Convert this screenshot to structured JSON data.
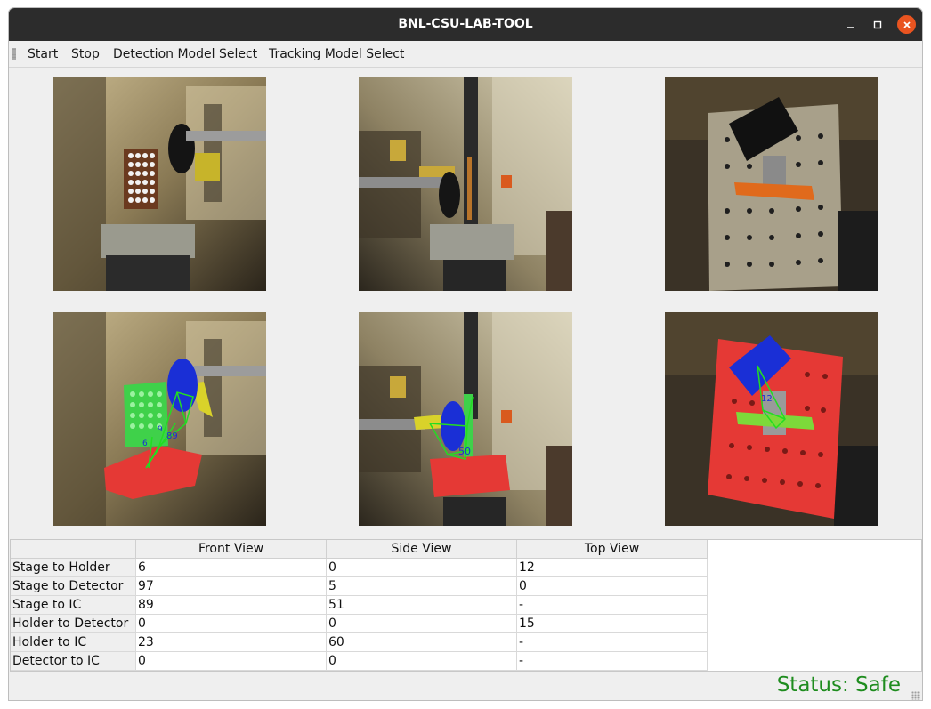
{
  "window": {
    "title": "BNL-CSU-LAB-TOOL",
    "controls": [
      "minimize-icon",
      "maximize-icon",
      "close-icon"
    ]
  },
  "menu": {
    "items": [
      "Start",
      "Stop",
      "Detection Model Select",
      "Tracking Model Select"
    ]
  },
  "images": {
    "raw": [
      "front-view-camera-image",
      "side-view-camera-image",
      "top-view-camera-image"
    ],
    "annotated": [
      "front-view-detection-image",
      "side-view-detection-image",
      "top-view-detection-image"
    ],
    "overlay_labels": {
      "front": [
        "89",
        "6",
        "9"
      ],
      "side": [
        "50"
      ],
      "top": [
        "12"
      ]
    }
  },
  "table": {
    "columns": [
      "Front View",
      "Side View",
      "Top View"
    ],
    "rows": [
      {
        "label": "Stage to Holder",
        "values": [
          "6",
          "0",
          "12"
        ]
      },
      {
        "label": "Stage to Detector",
        "values": [
          "97",
          "5",
          "0"
        ]
      },
      {
        "label": "Stage to IC",
        "values": [
          "89",
          "51",
          "-"
        ]
      },
      {
        "label": "Holder to Detector",
        "values": [
          "0",
          "0",
          "15"
        ]
      },
      {
        "label": "Holder to IC",
        "values": [
          "23",
          "60",
          "-"
        ]
      },
      {
        "label": "Detector to IC",
        "values": [
          "0",
          "0",
          "-"
        ]
      }
    ]
  },
  "status": {
    "text": "Status: Safe",
    "color": "#1e8c1e"
  },
  "colors": {
    "titlebar": "#2c2c2c",
    "close_button": "#e95420",
    "stage_overlay": "#e53935",
    "holder_overlay": "#2ecc40",
    "detector_overlay": "#1a2fd6",
    "keypoint_lines": "#22dd22"
  }
}
